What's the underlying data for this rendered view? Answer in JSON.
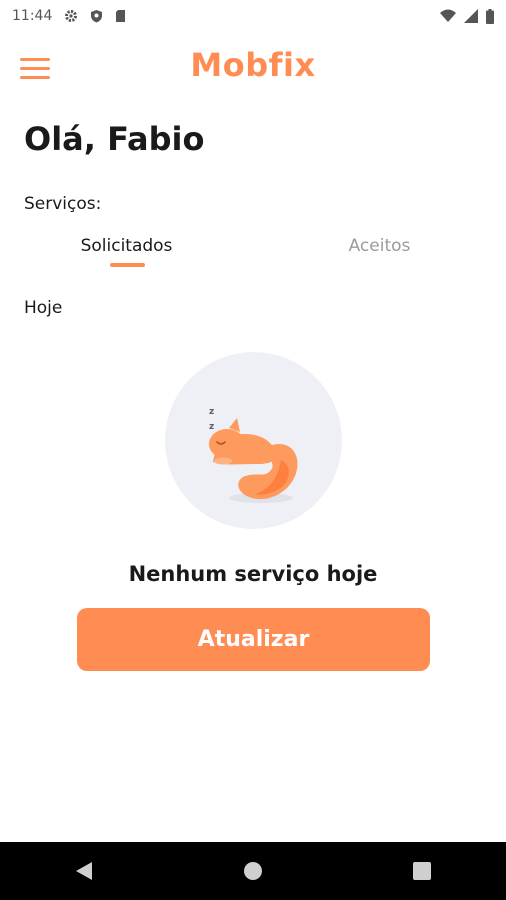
{
  "status_bar": {
    "time": "11:44",
    "icons": [
      "gear-icon",
      "shield-icon",
      "sd-card-icon",
      "wifi-icon",
      "signal-icon",
      "battery-icon"
    ]
  },
  "app_bar": {
    "title": "Mobfix",
    "menu_icon": "hamburger-menu-icon",
    "accent_color": "#ff8c52"
  },
  "main": {
    "greeting": "Olá, Fabio",
    "services_label": "Serviços:",
    "tabs": [
      {
        "label": "Solicitados",
        "selected": true
      },
      {
        "label": "Aceitos",
        "selected": false
      }
    ],
    "section_label": "Hoje",
    "empty_state": {
      "illustration": "sleeping-squirrel-illustration",
      "message": "Nenhum serviço hoje"
    },
    "refresh_button_label": "Atualizar"
  },
  "nav_bar": {
    "buttons": [
      "back-icon",
      "home-icon",
      "recents-icon"
    ]
  }
}
